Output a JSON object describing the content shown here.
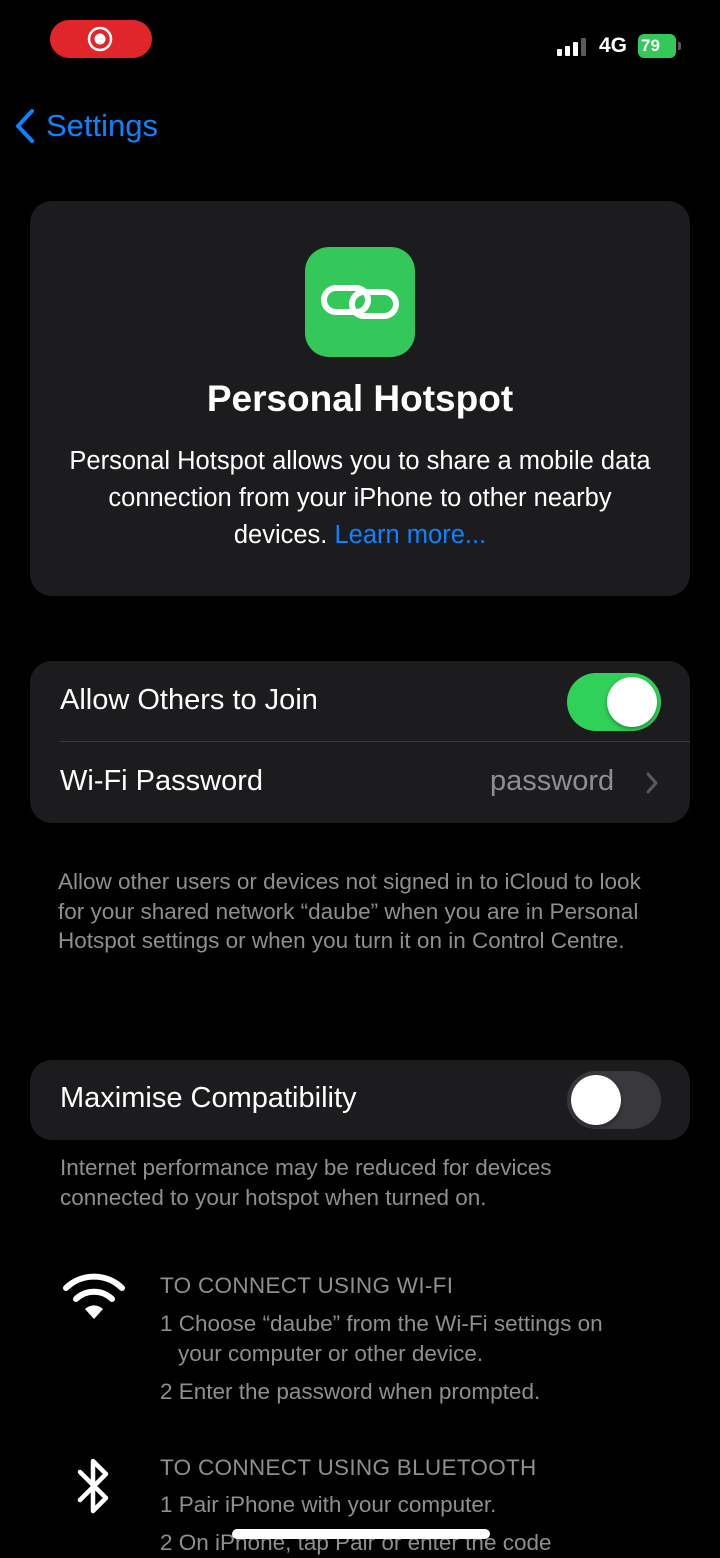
{
  "status_bar": {
    "network": "4G",
    "battery": "79",
    "signal_bars": 4,
    "signal_bars_active": 3,
    "recording": true
  },
  "nav": {
    "back_label": "Settings"
  },
  "hero": {
    "icon": "link-chain-icon",
    "title": "Personal Hotspot",
    "description": "Personal Hotspot allows you to share a mobile data connection from your iPhone to other nearby devices.",
    "learn_more": "Learn more..."
  },
  "settings": {
    "allow_others": {
      "label": "Allow Others to Join",
      "enabled": true
    },
    "wifi_password": {
      "label": "Wi-Fi Password",
      "value": "password"
    },
    "allow_footer": "Allow other users or devices not signed in to iCloud to look for your shared network “daube” when you are in Personal Hotspot settings or when you turn it on in Control Centre.",
    "maximise": {
      "label": "Maximise Compatibility",
      "enabled": false
    },
    "maximise_footer": "Internet performance may be reduced for devices connected to your hotspot when turned on."
  },
  "instructions": {
    "wifi": {
      "icon": "wifi-icon",
      "title": "TO CONNECT USING WI-FI",
      "step1_a": "1 Choose “daube” from the Wi-Fi settings on",
      "step1_b": "your computer or other device.",
      "step2": "2 Enter the password when prompted."
    },
    "bluetooth": {
      "icon": "bluetooth-icon",
      "title": "TO CONNECT USING BLUETOOTH",
      "step1": "1 Pair iPhone with your computer.",
      "step2": "2 On iPhone, tap Pair or enter the code"
    }
  },
  "colors": {
    "accent": "#0a84ff",
    "toggle_on": "#30d158",
    "card_bg": "#1c1c1e",
    "secondary_text": "#8e8e93",
    "record_red": "#e0262b"
  }
}
